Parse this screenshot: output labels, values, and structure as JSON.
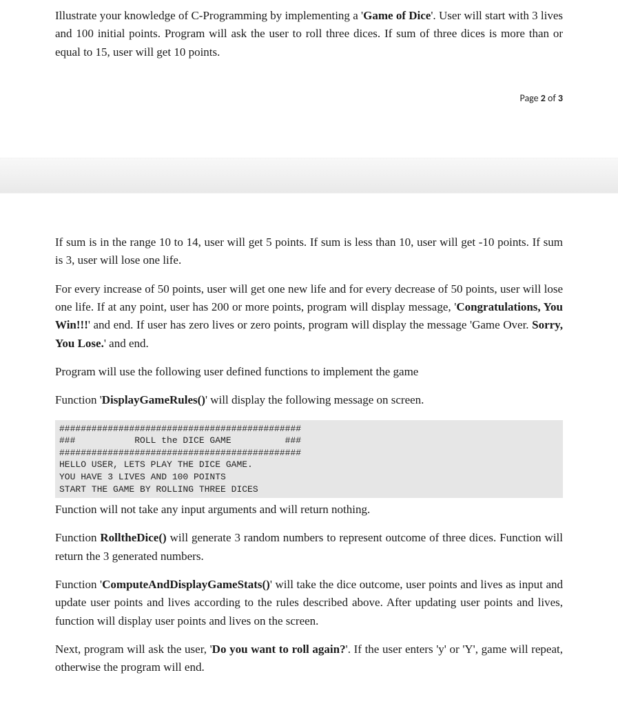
{
  "page1": {
    "p1_a": "Illustrate your knowledge of C-Programming by implementing a '",
    "p1_b": "Game of Dice",
    "p1_c": "'. User will start with 3 lives and 100 initial points. Program will ask the user to roll three dices.  If sum of three dices is more than or equal to 15, user will get 10 points.",
    "pagenum_a": "Page ",
    "pagenum_b": "2",
    "pagenum_c": " of ",
    "pagenum_d": "3"
  },
  "page2": {
    "p2": "If sum is in the range 10 to 14, user will get 5 points. If sum is less than 10, user will get -10 points. If sum is 3, user will lose one life.",
    "p3_a": "For every increase of 50 points, user will get one new life and for every decrease of 50 points, user will lose one life. If at any point, user has 200 or more points, program will display message, '",
    "p3_b": "Congratulations, You Win!!!",
    "p3_c": "' and end. If user has zero lives or zero points, program will display the message 'Game Over. ",
    "p3_d": "Sorry, You Lose.",
    "p3_e": "' and end.",
    "p4": "Program will use the following user defined functions to implement the game",
    "p5_a": "Function '",
    "p5_b": "DisplayGameRules()",
    "p5_c": "' will display the following message on screen.",
    "code": "#############################################\n###           ROLL the DICE GAME          ###\n#############################################\nHELLO USER, LETS PLAY THE DICE GAME.\nYOU HAVE 3 LIVES AND 100 POINTS\nSTART THE GAME BY ROLLING THREE DICES",
    "p6": "Function will not take any input arguments and will return nothing.",
    "p7_a": "Function ",
    "p7_b": "RolltheDice()",
    "p7_c": " will generate 3 random numbers to represent outcome of three dices. Function will return the 3 generated numbers.",
    "p8_a": "Function '",
    "p8_b": "ComputeAndDisplayGameStats()",
    "p8_c": "' will take the dice outcome, user points and lives as input and update user points and lives according to the rules described above. After updating user points and lives, function will display user points and lives on the screen.",
    "p9_a": "Next, program will ask the user, '",
    "p9_b": "Do you want to roll again?",
    "p9_c": "'. If the user enters 'y' or 'Y', game will repeat, otherwise the program will end."
  }
}
